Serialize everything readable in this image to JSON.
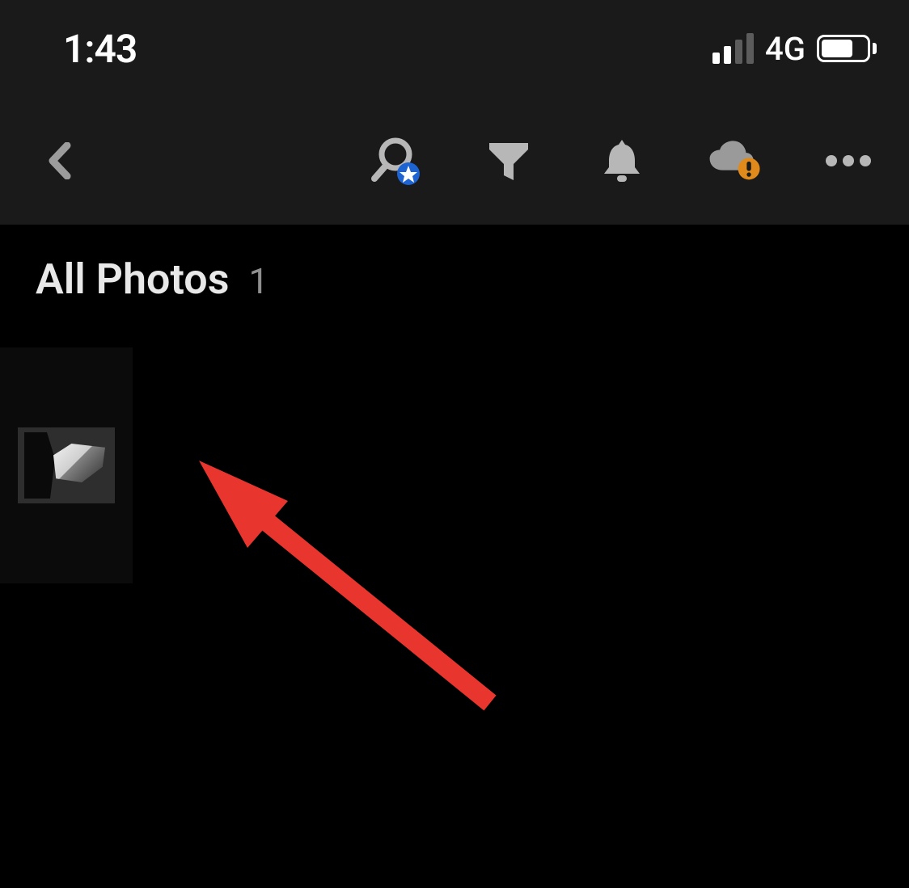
{
  "status": {
    "time": "1:43",
    "network_label": "4G",
    "signal_active_bars": 2,
    "battery_percent_approx": 70
  },
  "toolbar": {
    "icons": {
      "back": "back-chevron-icon",
      "search": "search-star-icon",
      "filter": "filter-funnel-icon",
      "notifications": "bell-icon",
      "cloud": "cloud-alert-icon",
      "more": "more-dots-icon"
    },
    "colors": {
      "cloud_alert_badge": "#e08a1c",
      "search_star_badge": "#1d63d1"
    }
  },
  "header": {
    "title": "All Photos",
    "count": "1"
  },
  "grid": {
    "items": [
      {
        "id": "photo-1",
        "alt": "black and white thumbnail"
      }
    ]
  },
  "annotation": {
    "present": true,
    "arrow_color": "#e8362f"
  }
}
